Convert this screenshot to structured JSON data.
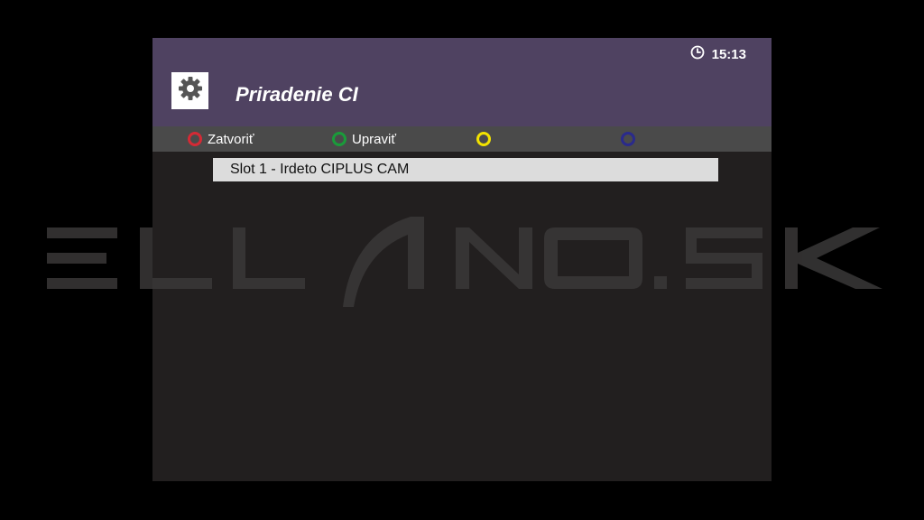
{
  "header": {
    "title": "Priradenie CI",
    "clock": "15:13",
    "settings_icon": "gear-icon",
    "clock_icon": "clock-icon"
  },
  "keys": [
    {
      "label": "Zatvoriť",
      "color": "#d42a35"
    },
    {
      "label": "Upraviť",
      "color": "#1a9b3a"
    },
    {
      "label": "",
      "color": "#f2e200"
    },
    {
      "label": "",
      "color": "#2a2a8c"
    }
  ],
  "list": {
    "items": [
      "Slot 1 - Irdeto CIPLUS CAM"
    ]
  },
  "watermark": {
    "text": "ELLANO.SK"
  },
  "colors": {
    "header_bg": "#4f4261",
    "keybar_bg": "#4a4a4a",
    "body_bg": "#221f1f",
    "selection_bg": "#dcdcdc"
  }
}
